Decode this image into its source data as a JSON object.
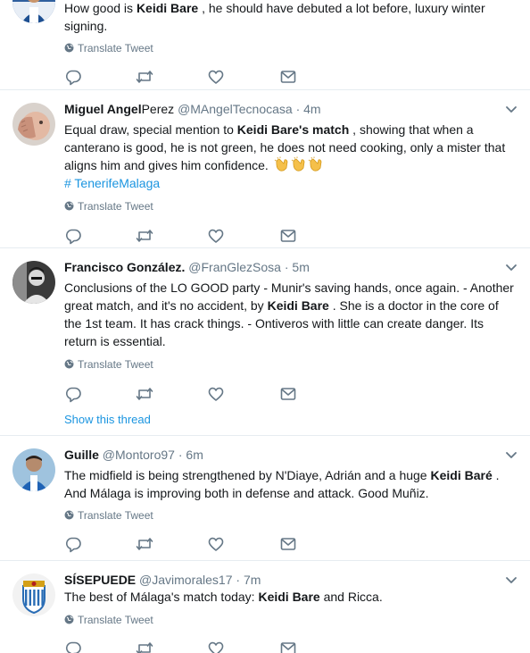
{
  "tweets": [
    {
      "avatar": "player-avatar",
      "name": "",
      "handle": "",
      "time": "",
      "text": [
        {
          "t": "How good is "
        },
        {
          "t": "Keidi Bare",
          "b": true
        },
        {
          "t": " , he should have debuted a lot before, luxury winter signing."
        }
      ],
      "translate": "Translate Tweet"
    },
    {
      "avatar": "hand-face-avatar",
      "name": "Miguel Angel",
      "name_rest": "Perez",
      "handle": "@MAngelTecnocasa",
      "dot": "·",
      "time": "4m",
      "text": [
        {
          "t": "Equal draw, special mention to "
        },
        {
          "t": "Keidi Bare's match",
          "b": true
        },
        {
          "t": " , showing that when a canterano is good, he is not green, he does not need cooking, only a mister that aligns him and gives him confidence. "
        }
      ],
      "emoji": "clapping-hands-icon",
      "hashtag": "# TenerifeMalaga",
      "translate": "Translate Tweet"
    },
    {
      "avatar": "man-avatar",
      "name": "Francisco González.",
      "handle": "@FranGlezSosa",
      "dot": "·",
      "time": "5m",
      "text": [
        {
          "t": "Conclusions of the LO GOOD party - Munir's saving hands, once again. - Another great match, and it's no accident, by "
        },
        {
          "t": "Keidi Bare",
          "b": true
        },
        {
          "t": " . She is a doctor in the core of the 1st team. It has crack things. - Ontiveros with little can create danger. Its return is essential."
        }
      ],
      "translate": "Translate Tweet",
      "show_thread": "Show this thread"
    },
    {
      "avatar": "player-blue-avatar",
      "name": "Guille",
      "handle": "@Montoro97",
      "dot": "·",
      "time": "6m",
      "text": [
        {
          "t": "The midfield is being strengthened by N'Diaye, Adrián and a huge "
        },
        {
          "t": "Keidi Baré",
          "b": true
        },
        {
          "t": " . And Málaga is improving both in defense and attack. Good Muñiz."
        }
      ],
      "translate": "Translate Tweet"
    },
    {
      "avatar": "malaga-crest-avatar",
      "name": "SÍSEPUEDE",
      "handle": "@Javimorales17",
      "dot": "·",
      "time": "7m",
      "text": [
        {
          "t": "The best of Málaga's match today: "
        },
        {
          "t": "Keidi Bare",
          "b": true
        },
        {
          "t": " and Ricca."
        }
      ],
      "translate": "Translate Tweet"
    }
  ],
  "icons": {
    "reply": "reply-icon",
    "retweet": "retweet-icon",
    "like": "heart-icon",
    "message": "message-icon",
    "caret": "chevron-down-icon",
    "globe": "globe-icon"
  },
  "colors": {
    "text": "#14171a",
    "muted": "#657786",
    "link": "#1b95e0",
    "divider": "#e6ecf0"
  }
}
